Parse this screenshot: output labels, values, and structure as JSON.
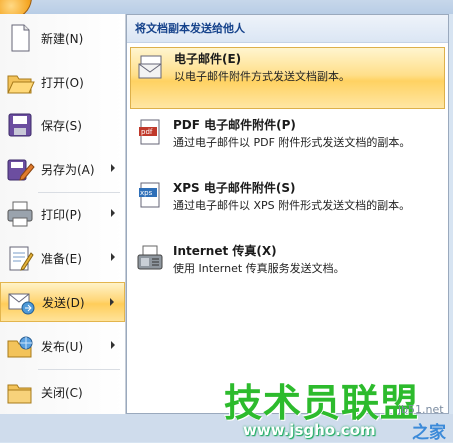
{
  "left_menu": [
    {
      "label": "新建(N)",
      "icon": "new-document-icon",
      "arrow": false
    },
    {
      "label": "打开(O)",
      "icon": "open-folder-icon",
      "arrow": false
    },
    {
      "label": "保存(S)",
      "icon": "save-disk-icon",
      "arrow": false
    },
    {
      "label": "另存为(A)",
      "icon": "save-as-icon",
      "arrow": true
    },
    {
      "label": "打印(P)",
      "icon": "printer-icon",
      "arrow": true
    },
    {
      "label": "准备(E)",
      "icon": "prepare-icon",
      "arrow": true
    },
    {
      "label": "发送(D)",
      "icon": "send-icon",
      "arrow": true,
      "selected": true
    },
    {
      "label": "发布(U)",
      "icon": "publish-icon",
      "arrow": true
    },
    {
      "label": "关闭(C)",
      "icon": "close-folder-icon",
      "arrow": false
    }
  ],
  "submenu": {
    "header": "将文档副本发送给他人",
    "items": [
      {
        "title": "电子邮件(E)",
        "desc": "以电子邮件附件方式发送文档副本。",
        "icon": "email-icon",
        "selected": true
      },
      {
        "title": "PDF 电子邮件附件(P)",
        "desc": "通过电子邮件以 PDF 附件形式发送文档的副本。",
        "icon": "pdf-email-icon"
      },
      {
        "title": "XPS 电子邮件附件(S)",
        "desc": "通过电子邮件以 XPS 附件形式发送文档的副本。",
        "icon": "xps-email-icon"
      },
      {
        "title": "Internet 传真(X)",
        "desc": "使用 Internet 传真服务发送文档。",
        "icon": "fax-icon"
      }
    ]
  },
  "watermark": {
    "main": "技术员联盟",
    "url": "www.jsgho.com",
    "suffix": "之家",
    "site": "jb51.net"
  },
  "colors": {
    "highlight": "#ffd262",
    "header_text": "#15428b"
  }
}
